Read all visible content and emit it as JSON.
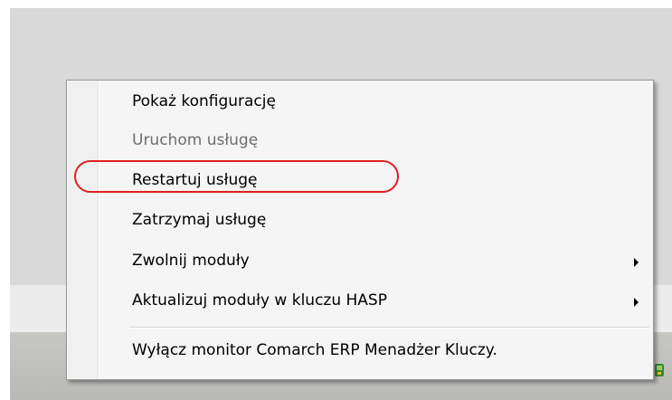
{
  "menu": {
    "items": [
      {
        "label": "Pokaż konfigurację",
        "enabled": true,
        "submenu": false
      },
      {
        "label": "Uruchom usługę",
        "enabled": false,
        "submenu": false
      },
      {
        "label": "Restartuj usługę",
        "enabled": true,
        "submenu": false
      },
      {
        "label": "Zatrzymaj usługę",
        "enabled": true,
        "submenu": false
      },
      {
        "label": "Zwolnij moduły",
        "enabled": true,
        "submenu": true
      },
      {
        "label": "Aktualizuj moduły w kluczu HASP",
        "enabled": true,
        "submenu": true
      },
      {
        "label": "Wyłącz monitor Comarch ERP Menadżer Kluczy.",
        "enabled": true,
        "submenu": false
      }
    ]
  },
  "highlight": {
    "target": "Restartuj usługę",
    "color": "#e02020"
  },
  "colors": {
    "menu_background": "#f5f5f5",
    "menu_border": "#979797",
    "disabled_text": "#6d6d6d",
    "desktop_background": "#d9d9d9",
    "taskbar": "#c0c0bd"
  },
  "icons": {
    "tray": "tray-app-icon",
    "submenu": "chevron-right-icon"
  }
}
